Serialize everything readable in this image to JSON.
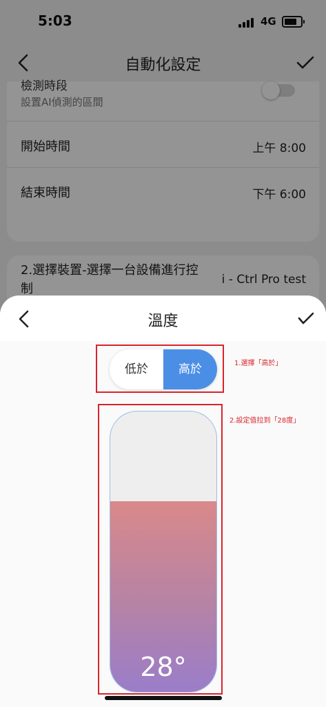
{
  "status_bar": {
    "time": "5:03",
    "network": "4G"
  },
  "background_page": {
    "title": "自動化設定",
    "partial_row": {
      "title": "檢測時段",
      "subtitle": "設置AI偵測的區間",
      "toggle_on": false
    },
    "rows": [
      {
        "label": "開始時間",
        "value": "上午 8:00"
      },
      {
        "label": "結束時間",
        "value": "下午 6:00"
      }
    ],
    "device_row": {
      "title": "2.選擇裝置-選擇一台設備進行控制",
      "value": "i - Ctrl Pro test"
    }
  },
  "sheet": {
    "title": "溫度",
    "segment": {
      "options": [
        "低於",
        "高於"
      ],
      "selected": "高於"
    },
    "slider": {
      "value_label": "28°",
      "fill_fraction": 0.68
    }
  },
  "annotations": {
    "step1": "1.選擇「高於」",
    "step2": "2.設定值拉到「28度」"
  },
  "colors": {
    "accent": "#4b8ee6",
    "annotation": "#d8232a",
    "slider_top": "#d9898a",
    "slider_bottom": "#9a7dc9"
  }
}
